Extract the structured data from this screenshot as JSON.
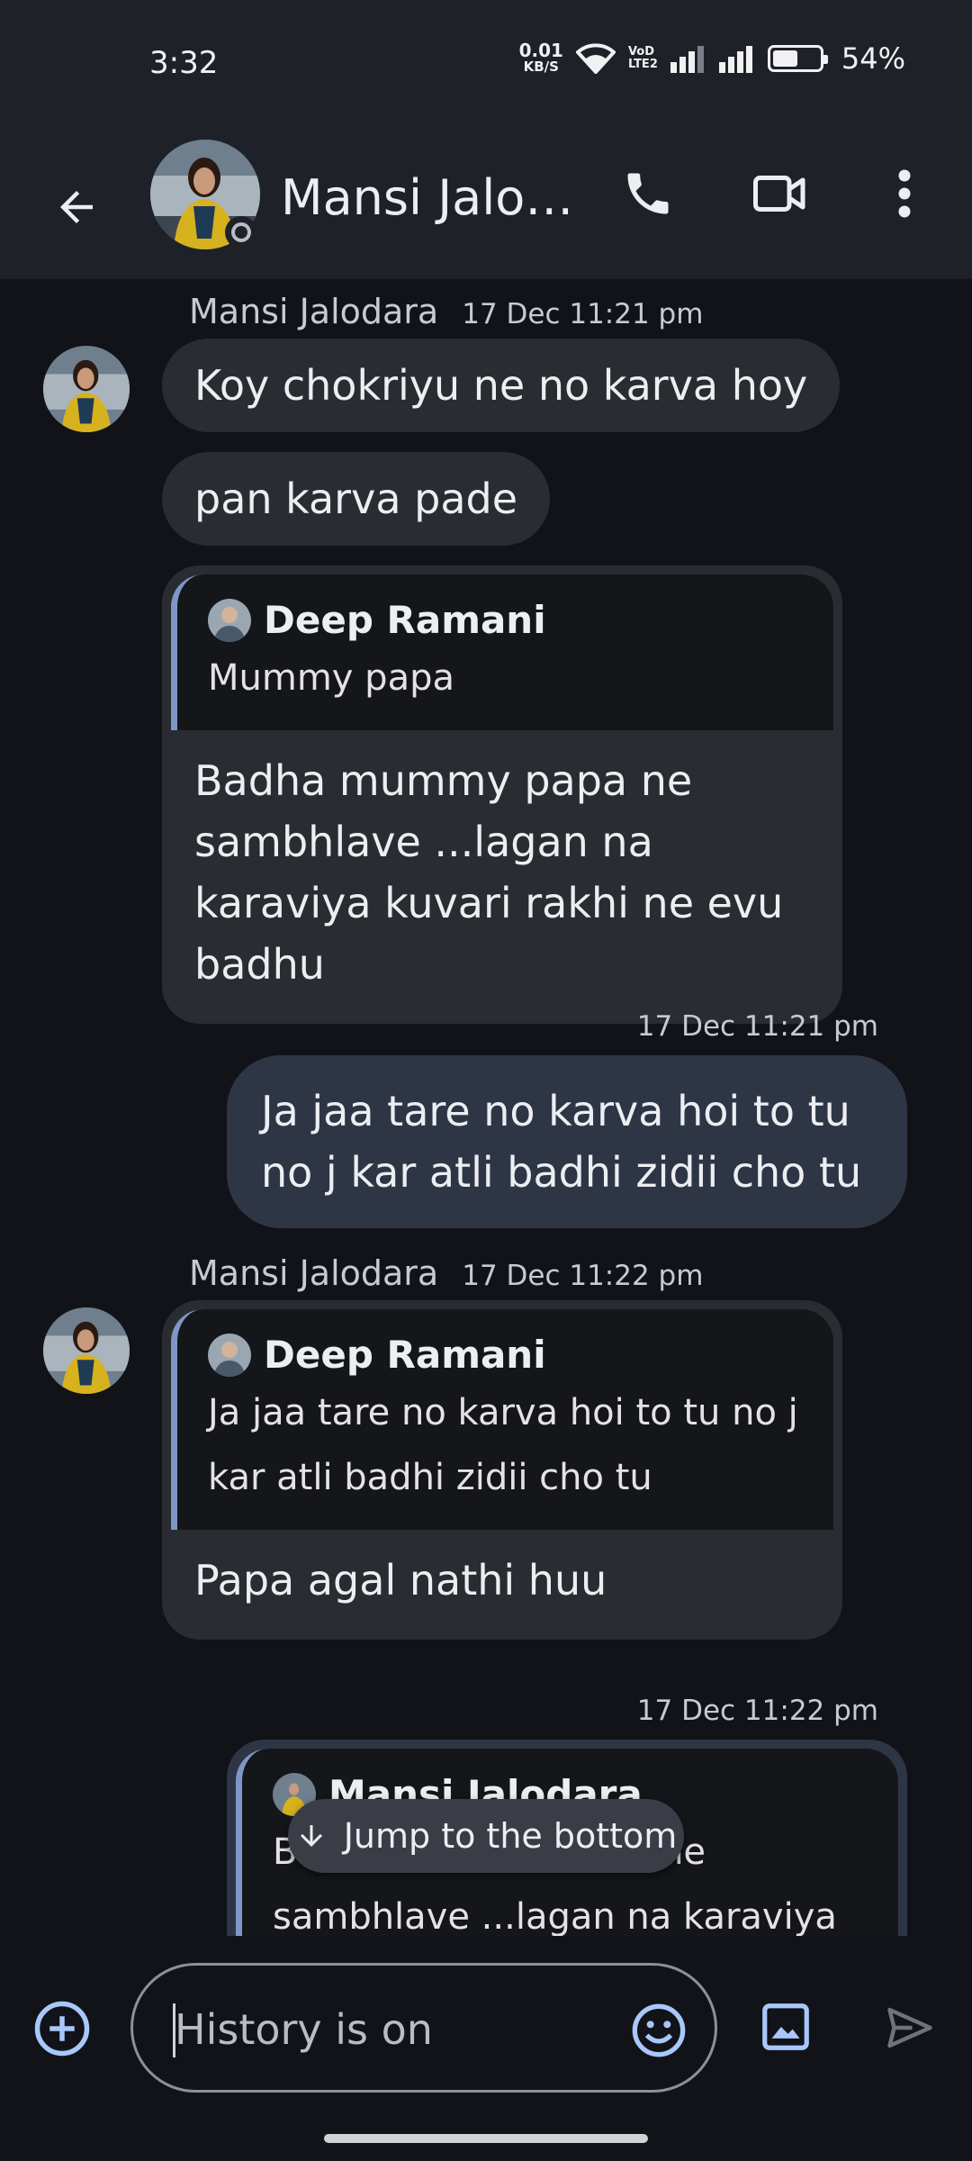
{
  "status": {
    "time": "3:32",
    "speed_value": "0.01",
    "speed_unit": "KB/S",
    "volte_top": "VoD",
    "volte_bottom": "LTE2",
    "battery": "54%",
    "battery_level": 0.54
  },
  "header": {
    "contact_name": "Mansi Jalo…"
  },
  "messages": [
    {
      "sender": "Mansi Jalodara",
      "time": "17 Dec 11:21 pm",
      "text": "Koy chokriyu ne no karva hoy"
    },
    {
      "text": "pan karva pade"
    },
    {
      "quote_author": "Deep Ramani",
      "quote_text": "Mummy papa",
      "text": "Badha mummy papa ne sambhlave ...lagan na karaviya kuvari rakhi ne evu badhu"
    },
    {
      "time": "17 Dec 11:21 pm",
      "text": "Ja jaa tare no karva hoi to tu no j kar atli badhi zidii cho tu"
    },
    {
      "sender": "Mansi Jalodara",
      "time": "17 Dec 11:22 pm",
      "quote_author": "Deep Ramani",
      "quote_text": "Ja jaa tare no karva hoi to tu no j kar atli badhi zidii cho tu",
      "text": "Papa agal nathi huu"
    },
    {
      "time": "17 Dec 11:22 pm",
      "quote_author": "Mansi Jalodara",
      "quote_text": "Badha mummy papa ne sambhlave ...lagan na karaviya"
    }
  ],
  "jump_button": "Jump to the bottom",
  "compose": {
    "placeholder": "History is on"
  },
  "colors": {
    "background": "#111318",
    "toolbar": "#1e2127",
    "incoming_bubble": "#2a2c32",
    "outgoing_bubble": "#2e3646",
    "quote_bar": "#7f97c6",
    "accent": "#a8c7fa"
  },
  "icons": [
    "back-arrow-icon",
    "phone-icon",
    "video-call-icon",
    "more-vert-icon",
    "add-circle-icon",
    "emoji-icon",
    "image-icon",
    "send-icon",
    "arrow-down-icon",
    "wifi-icon",
    "signal-icon",
    "battery-icon"
  ]
}
